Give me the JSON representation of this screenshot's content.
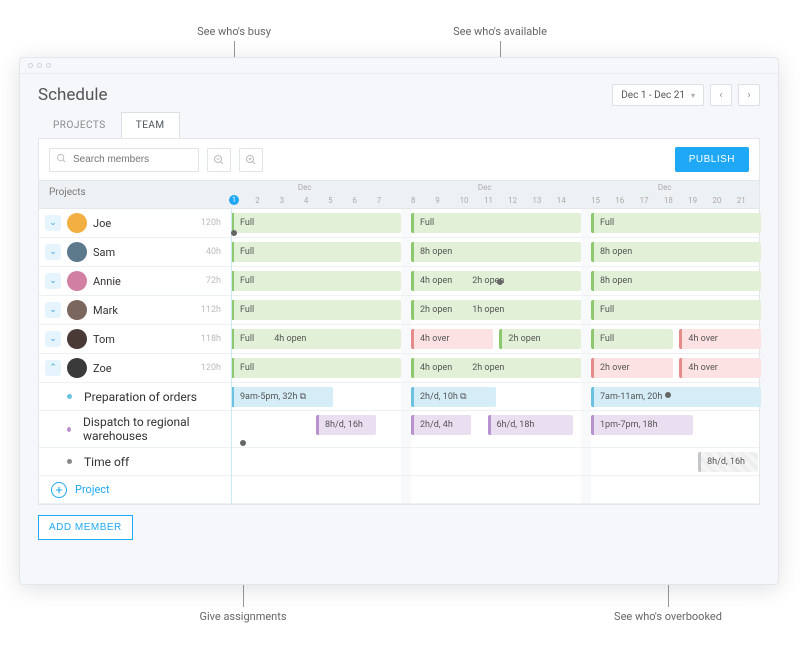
{
  "callouts": {
    "busy": "See who's busy",
    "available": "See who's available",
    "assignments": "Give assignments",
    "overbooked": "See who's overbooked"
  },
  "page_title": "Schedule",
  "date_range": "Dec 1 - Dec 21",
  "tabs": {
    "projects": "PROJECTS",
    "team": "TEAM"
  },
  "search_placeholder": "Search members",
  "publish_label": "PUBLISH",
  "projects_header": "Projects",
  "month_label": "Dec",
  "days": [
    1,
    2,
    3,
    4,
    5,
    6,
    7,
    8,
    9,
    10,
    11,
    12,
    13,
    14,
    15,
    16,
    17,
    18,
    19,
    20,
    21
  ],
  "members": [
    {
      "name": "Joe",
      "hours": "120h",
      "avatar_color": "#f2b042",
      "blocks": [
        {
          "col": 0,
          "cls": "full",
          "labels": [
            "Full"
          ]
        },
        {
          "col": 1,
          "cls": "full",
          "labels": [
            "Full"
          ]
        },
        {
          "col": 2,
          "cls": "full",
          "labels": [
            "Full"
          ]
        }
      ],
      "expanded": false
    },
    {
      "name": "Sam",
      "hours": "40h",
      "avatar_color": "#5c7a8c",
      "blocks": [
        {
          "col": 0,
          "cls": "full",
          "labels": [
            "Full"
          ]
        },
        {
          "col": 1,
          "cls": "full",
          "labels": [
            "8h open"
          ]
        },
        {
          "col": 2,
          "cls": "full",
          "labels": [
            "8h open"
          ]
        }
      ],
      "expanded": false
    },
    {
      "name": "Annie",
      "hours": "72h",
      "avatar_color": "#d17fa3",
      "blocks": [
        {
          "col": 0,
          "cls": "full",
          "labels": [
            "Full"
          ]
        },
        {
          "col": 1,
          "cls": "full",
          "labels": [
            "4h open",
            "2h open"
          ]
        },
        {
          "col": 2,
          "cls": "full",
          "labels": [
            "8h open"
          ]
        }
      ],
      "expanded": false
    },
    {
      "name": "Mark",
      "hours": "112h",
      "avatar_color": "#7a665c",
      "blocks": [
        {
          "col": 0,
          "cls": "full",
          "labels": [
            "Full"
          ]
        },
        {
          "col": 1,
          "cls": "full",
          "labels": [
            "2h open",
            "1h open"
          ]
        },
        {
          "col": 2,
          "cls": "full",
          "labels": [
            "Full"
          ]
        }
      ],
      "expanded": false
    },
    {
      "name": "Tom",
      "hours": "118h",
      "avatar_color": "#4a3a36",
      "blocks": [
        {
          "col": 0,
          "cls": "full",
          "labels": [
            "Full",
            "4h open"
          ]
        },
        {
          "col": 1,
          "cls": "over",
          "labels": [
            "4h over"
          ],
          "half": true
        },
        {
          "col": 1,
          "cls": "full",
          "labels": [
            "2h open"
          ],
          "half2": true
        },
        {
          "col": 2,
          "cls": "full",
          "labels": [
            "Full"
          ],
          "half": true
        },
        {
          "col": 2,
          "cls": "over",
          "labels": [
            "4h over"
          ],
          "half2": true
        }
      ],
      "expanded": false
    },
    {
      "name": "Zoe",
      "hours": "120h",
      "avatar_color": "#3a3a3a",
      "blocks": [
        {
          "col": 0,
          "cls": "full",
          "labels": [
            "Full"
          ]
        },
        {
          "col": 1,
          "cls": "full",
          "labels": [
            "4h open",
            "2h open"
          ]
        },
        {
          "col": 2,
          "cls": "over",
          "labels": [
            "2h over"
          ],
          "half": true
        },
        {
          "col": 2,
          "cls": "over",
          "labels": [
            "4h over"
          ],
          "half2": true
        }
      ],
      "expanded": true
    }
  ],
  "subprojects": [
    {
      "name": "Preparation of orders",
      "color": "#6ac2e0",
      "blocks": [
        {
          "col": 0,
          "cls": "blue",
          "labels": [
            "9am-5pm, 32h ⧉"
          ],
          "w": 0.6
        },
        {
          "col": 1,
          "cls": "blue",
          "labels": [
            "2h/d, 10h ⧉"
          ],
          "w": 0.5
        },
        {
          "col": 2,
          "cls": "blue",
          "labels": [
            "7am-11am, 20h"
          ],
          "w": 1
        }
      ]
    },
    {
      "name": "Dispatch to regional warehouses",
      "color": "#b891cf",
      "blocks": [
        {
          "col": 0,
          "cls": "purple",
          "labels": [
            "8h/d, 16h"
          ],
          "w": 0.35,
          "off": 0.5
        },
        {
          "col": 1,
          "cls": "purple",
          "labels": [
            "2h/d, 4h"
          ],
          "w": 0.35
        },
        {
          "col": 1,
          "cls": "purple",
          "labels": [
            "6h/d, 18h"
          ],
          "w": 0.5,
          "off": 0.45
        },
        {
          "col": 2,
          "cls": "purple",
          "labels": [
            "1pm-7pm, 18h"
          ],
          "w": 0.6
        }
      ]
    },
    {
      "name": "Time off",
      "color": "#888",
      "blocks": [
        {
          "col": 2,
          "cls": "gray",
          "labels": [
            "8h/d, 16h"
          ],
          "w": 0.35,
          "off": 0.63
        }
      ]
    }
  ],
  "add_project_label": "Project",
  "add_member_label": "ADD MEMBER"
}
